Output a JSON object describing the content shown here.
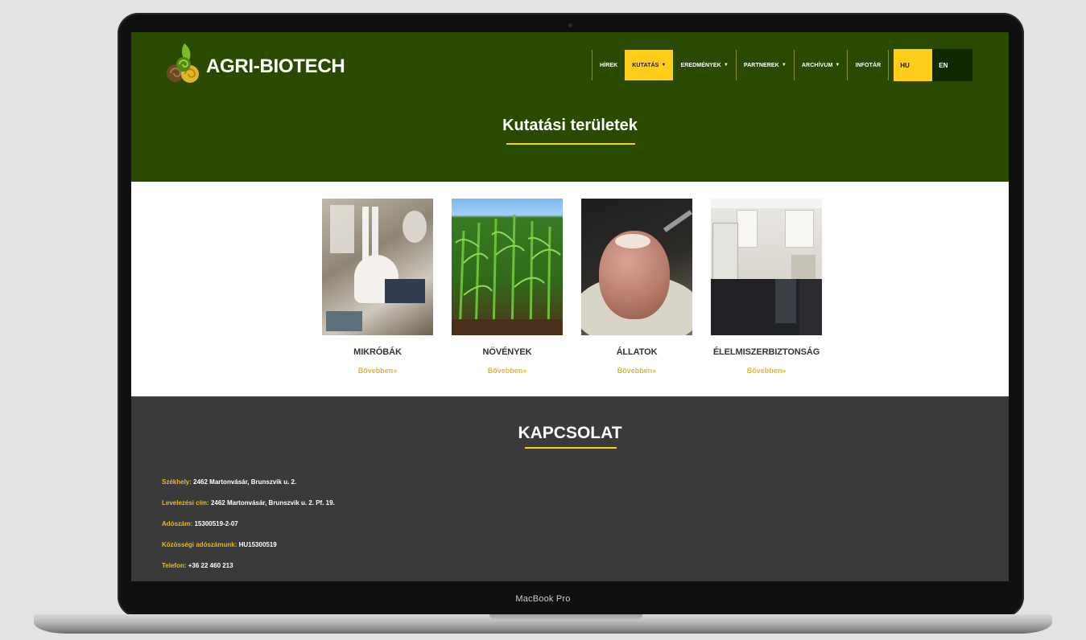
{
  "device": {
    "label": "MacBook Pro"
  },
  "header": {
    "brand": "AGRI-BIOTECH",
    "nav": [
      {
        "label": "HÍREK",
        "dropdown": false,
        "active": false
      },
      {
        "label": "KUTATÁS",
        "dropdown": true,
        "active": true
      },
      {
        "label": "EREDMÉNYEK",
        "dropdown": true,
        "active": false
      },
      {
        "label": "PARTNEREK",
        "dropdown": true,
        "active": false
      },
      {
        "label": "ARCHÍVUM",
        "dropdown": true,
        "active": false
      },
      {
        "label": "INFOTÁR",
        "dropdown": false,
        "active": false
      }
    ],
    "languages": {
      "hu": "HU",
      "en": "EN",
      "active": "HU"
    },
    "page_title": "Kutatási területek"
  },
  "research": {
    "items": [
      {
        "name": "MIKRÓBÁK",
        "more": "Bővebben»"
      },
      {
        "name": "NÖVÉNYEK",
        "more": "Bővebben»"
      },
      {
        "name": "ÁLLATOK",
        "more": "Bővebben»"
      },
      {
        "name": "ÉLELMISZERBIZTONSÁG",
        "more": "Bővebben»"
      }
    ]
  },
  "contact": {
    "title": "KAPCSOLAT",
    "lines": [
      {
        "label": "Székhely:",
        "value": "2462 Martonvásár, Brunszvik u. 2."
      },
      {
        "label": "Levelezési cím:",
        "value": "2462 Martonvásár, Brunszvik u. 2. Pf. 19."
      },
      {
        "label": "Adószám:",
        "value": "15300519-2-07"
      },
      {
        "label": "Közösségi adószámunk:",
        "value": "HU15300519"
      },
      {
        "label": "Telefon:",
        "value": "+36 22 460 213"
      }
    ]
  },
  "colors": {
    "header_bg": "#2a4a00",
    "accent": "#ffcc1a",
    "contact_bg": "#3a3a3a",
    "more_link": "#d8b83a"
  }
}
